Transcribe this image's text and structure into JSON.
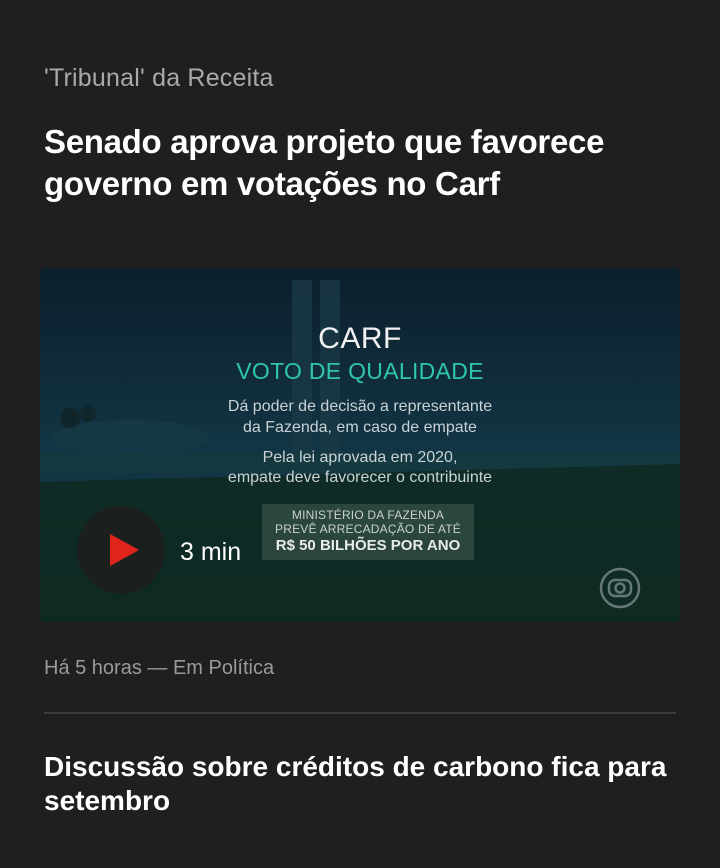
{
  "article": {
    "kicker": "'Tribunal' da Receita",
    "headline": "Senado aprova projeto que favorece governo em votações no Carf",
    "video": {
      "overlay_title": "CARF",
      "overlay_subtitle": "VOTO DE QUALIDADE",
      "overlay_line1": "Dá poder de decisão a representante",
      "overlay_line2": "da Fazenda, em caso de empate",
      "overlay_line3": "Pela lei aprovada em 2020,",
      "overlay_line4": "empate deve favorecer o contribuinte",
      "box_line1": "MINISTÉRIO DA FAZENDA",
      "box_line2": "PREVÊ ARRECADAÇÃO DE ATÉ",
      "box_line3": "R$ 50 BILHÕES POR ANO",
      "duration": "3 min",
      "play_icon": "play-icon",
      "logo_icon": "globo-logo-icon"
    },
    "meta": "Há 5 horas — Em Política"
  },
  "next_article": {
    "headline": "Discussão sobre créditos de carbono fica para setembro"
  },
  "colors": {
    "background": "#1f1f1f",
    "play_red": "#e0241c",
    "overlay_accent": "#2fc7a8"
  }
}
